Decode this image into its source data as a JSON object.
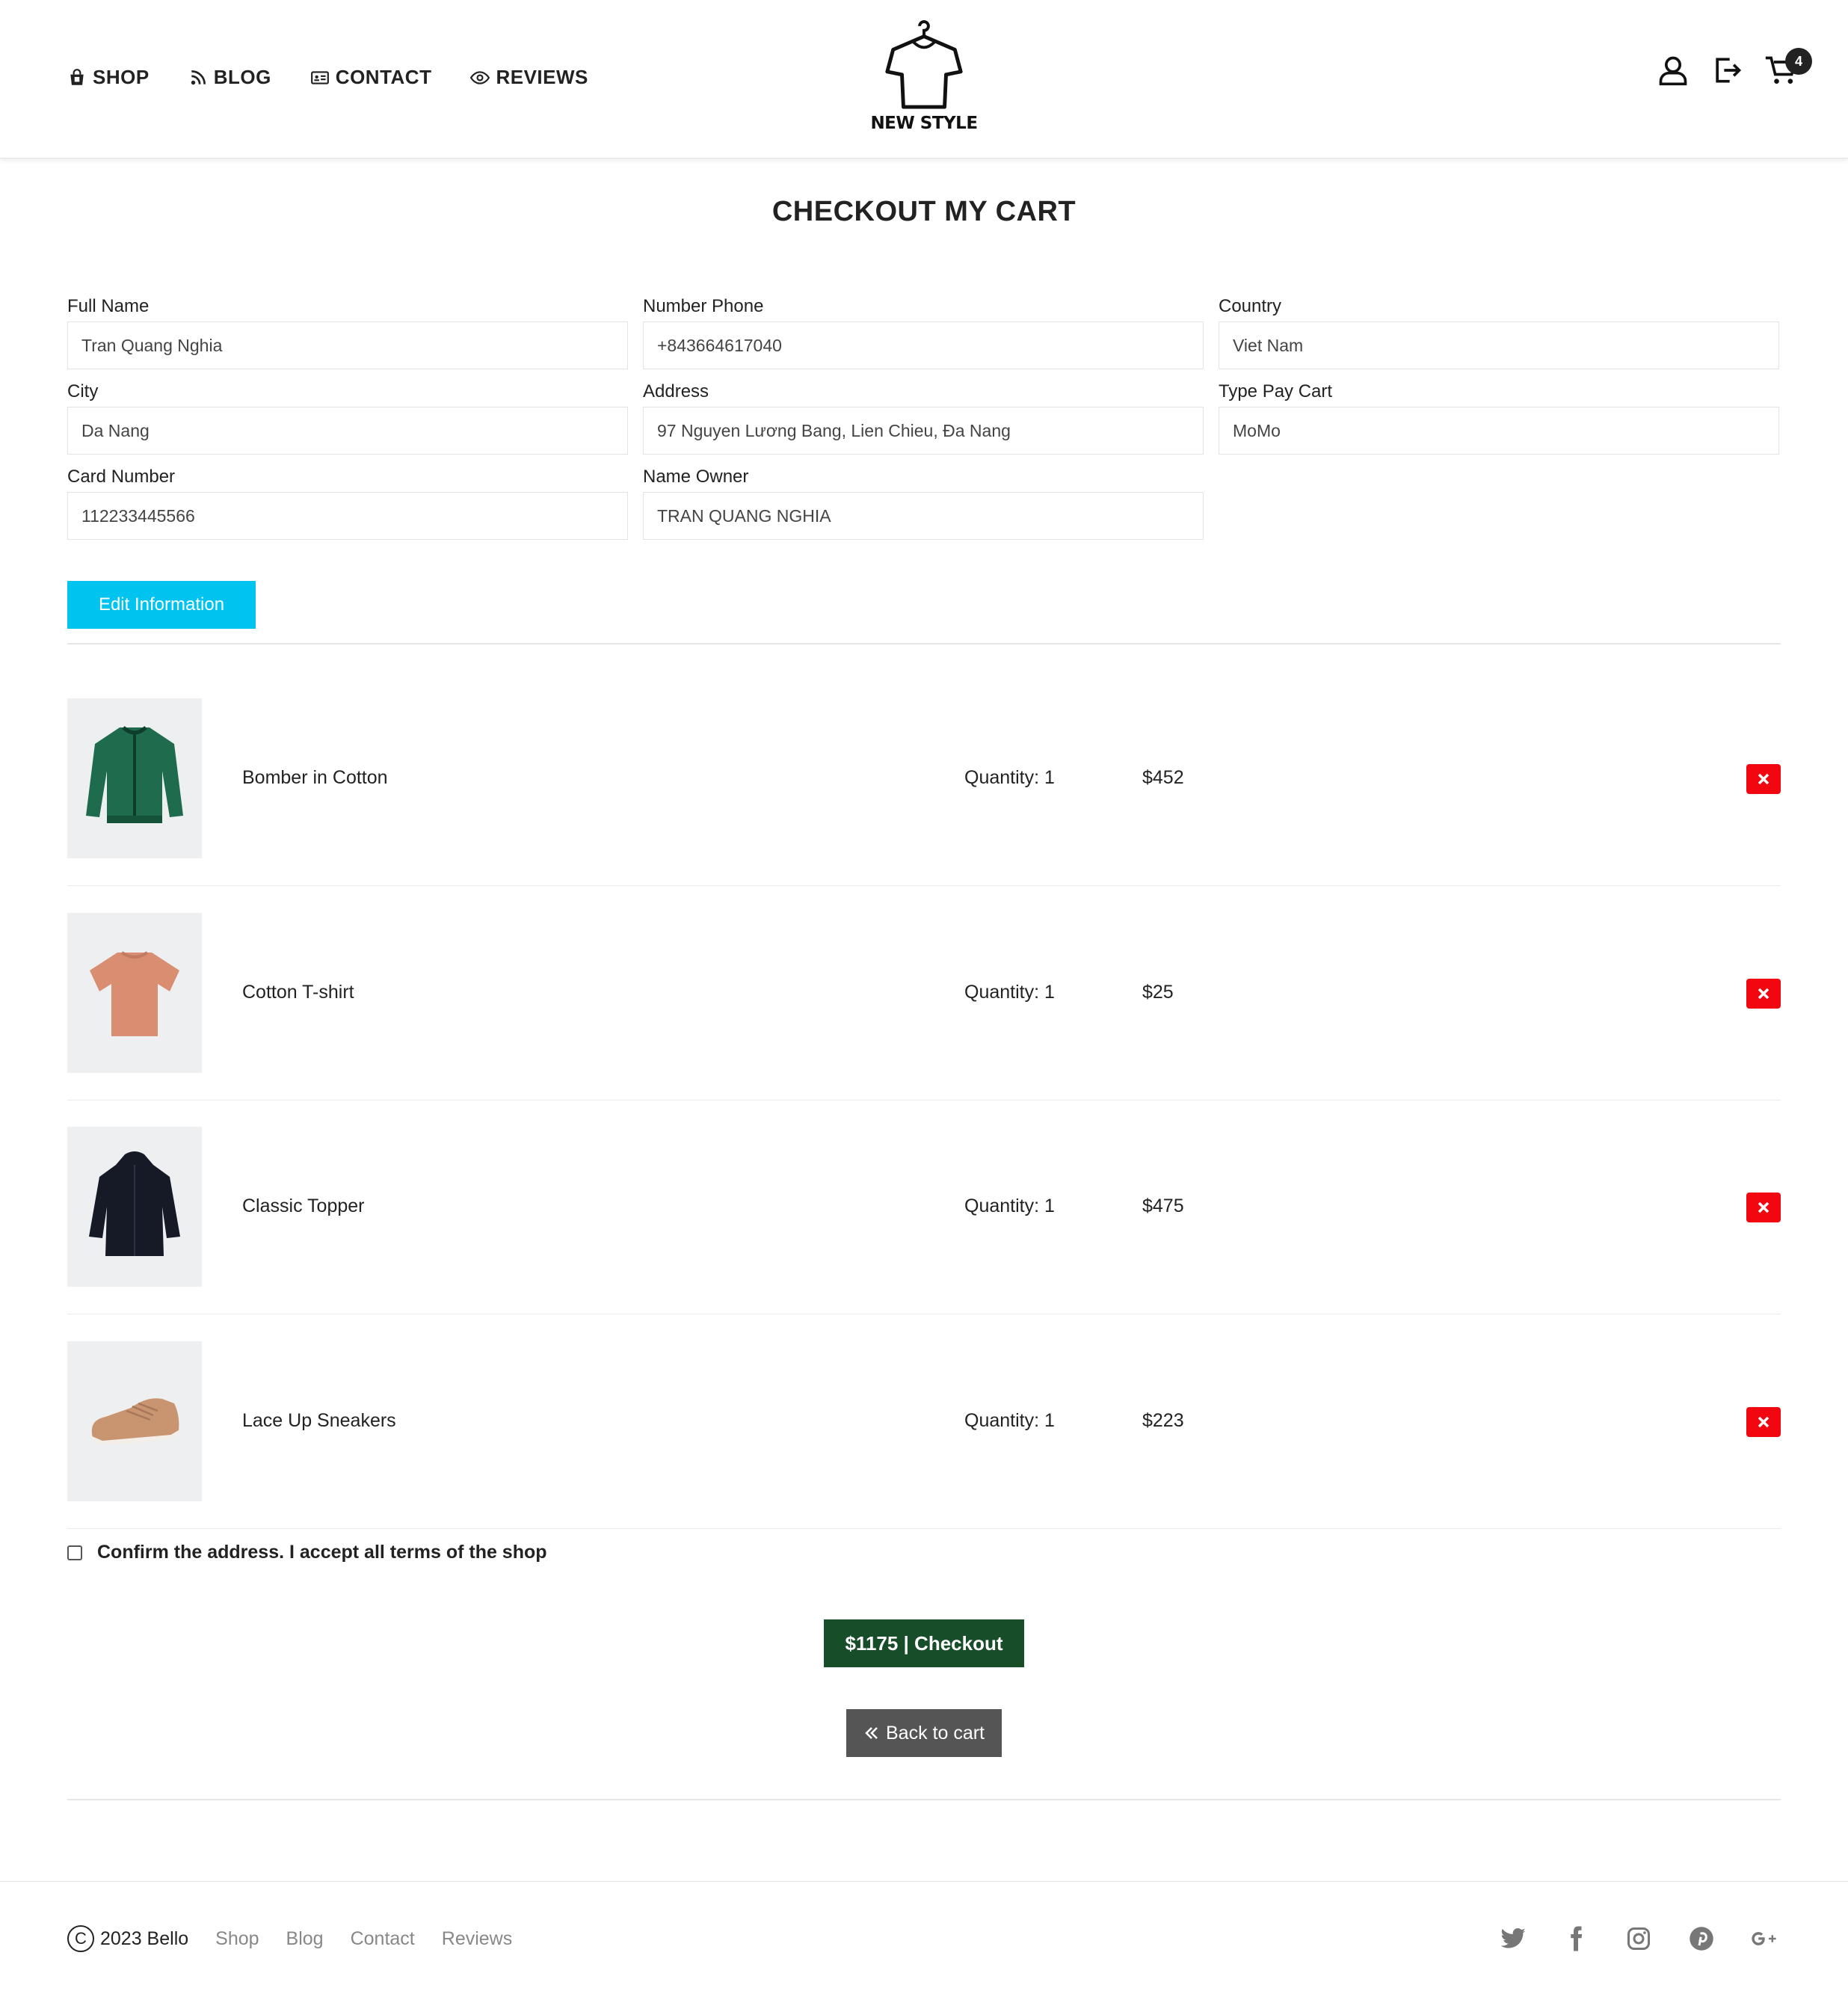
{
  "nav": {
    "items": [
      {
        "label": "SHOP",
        "icon": "shop-bag-icon"
      },
      {
        "label": "BLOG",
        "icon": "blog-icon"
      },
      {
        "label": "CONTACT",
        "icon": "contact-card-icon"
      },
      {
        "label": "REVIEWS",
        "icon": "eye-icon"
      }
    ]
  },
  "logo": {
    "text": "NEW STYLE"
  },
  "header": {
    "cart_count": "4"
  },
  "page": {
    "title": "CHECKOUT MY CART"
  },
  "form": {
    "full_name": {
      "label": "Full Name",
      "value": "Tran Quang Nghia"
    },
    "phone": {
      "label": "Number Phone",
      "value": "+843664617040"
    },
    "country": {
      "label": "Country",
      "value": "Viet Nam"
    },
    "city": {
      "label": "City",
      "value": "Da Nang"
    },
    "address": {
      "label": "Address",
      "value": "97 Nguyen Lương Bang, Lien Chieu, Đa Nang"
    },
    "pay_type": {
      "label": "Type Pay Cart",
      "value": "MoMo"
    },
    "card_number": {
      "label": "Card Number",
      "value": "112233445566"
    },
    "name_owner": {
      "label": "Name Owner",
      "value": "TRAN QUANG NGHIA"
    },
    "edit_button": "Edit Information"
  },
  "cart": {
    "items": [
      {
        "name": "Bomber in Cotton",
        "quantity": "Quantity: 1",
        "price": "$452",
        "color": "#1e6b4e"
      },
      {
        "name": "Cotton T-shirt",
        "quantity": "Quantity: 1",
        "price": "$25",
        "color": "#d98e72"
      },
      {
        "name": "Classic Topper",
        "quantity": "Quantity: 1",
        "price": "$475",
        "color": "#151a26"
      },
      {
        "name": "Lace Up Sneakers",
        "quantity": "Quantity: 1",
        "price": "$223",
        "color": "#c99570"
      }
    ]
  },
  "confirm": {
    "label": "Confirm the address. I accept all terms of the shop"
  },
  "checkout": {
    "label": "$1175 | Checkout"
  },
  "back": {
    "label": "Back to cart"
  },
  "footer": {
    "copyright": "2023 Bello",
    "links": [
      "Shop",
      "Blog",
      "Contact",
      "Reviews"
    ],
    "social": [
      "twitter-icon",
      "facebook-icon",
      "instagram-icon",
      "pinterest-icon",
      "google-plus-icon"
    ]
  },
  "colors": {
    "accent": "#00c4ef",
    "checkout": "#184d2a",
    "delete": "#f2060f",
    "back": "#555555"
  }
}
